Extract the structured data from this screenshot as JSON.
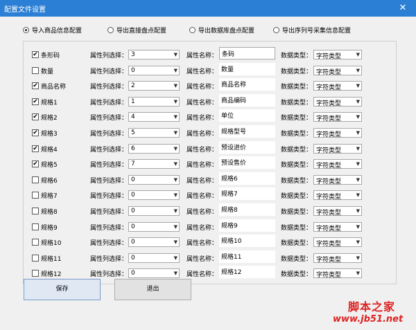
{
  "window": {
    "title": "配置文件设置",
    "close_glyph": "✕"
  },
  "tabs": [
    {
      "label": "导入商品信息配置",
      "selected": true
    },
    {
      "label": "导出直接盘点配置",
      "selected": false
    },
    {
      "label": "导出数据库盘点配置",
      "selected": false
    },
    {
      "label": "导出序列号采集信息配置",
      "selected": false
    }
  ],
  "labels": {
    "col_select": "属性列选择：",
    "attr_name": "属性名称：",
    "data_type": "数据类型："
  },
  "rows": [
    {
      "checked": true,
      "label": "条形码",
      "col": "3",
      "name": "条码",
      "name_framed": true,
      "type": "字符类型"
    },
    {
      "checked": false,
      "label": "数量",
      "col": "0",
      "name": "数量",
      "name_framed": false,
      "type": "字符类型"
    },
    {
      "checked": true,
      "label": "商品名称",
      "col": "2",
      "name": "商品名称",
      "name_framed": false,
      "type": "字符类型"
    },
    {
      "checked": true,
      "label": "规格1",
      "col": "1",
      "name": "商品编码",
      "name_framed": false,
      "type": "字符类型"
    },
    {
      "checked": true,
      "label": "规格2",
      "col": "4",
      "name": "单位",
      "name_framed": false,
      "type": "字符类型"
    },
    {
      "checked": true,
      "label": "规格3",
      "col": "5",
      "name": "规格型号",
      "name_framed": false,
      "type": "字符类型"
    },
    {
      "checked": true,
      "label": "规格4",
      "col": "6",
      "name": "预设进价",
      "name_framed": false,
      "type": "字符类型"
    },
    {
      "checked": true,
      "label": "规格5",
      "col": "7",
      "name": "预设售价",
      "name_framed": false,
      "type": "字符类型"
    },
    {
      "checked": false,
      "label": "规格6",
      "col": "0",
      "name": "规格6",
      "name_framed": false,
      "type": "字符类型"
    },
    {
      "checked": false,
      "label": "规格7",
      "col": "0",
      "name": "规格7",
      "name_framed": false,
      "type": "字符类型"
    },
    {
      "checked": false,
      "label": "规格8",
      "col": "0",
      "name": "规格8",
      "name_framed": false,
      "type": "字符类型"
    },
    {
      "checked": false,
      "label": "规格9",
      "col": "0",
      "name": "规格9",
      "name_framed": false,
      "type": "字符类型"
    },
    {
      "checked": false,
      "label": "规格10",
      "col": "0",
      "name": "规格10",
      "name_framed": false,
      "type": "字符类型"
    },
    {
      "checked": false,
      "label": "规格11",
      "col": "0",
      "name": "规格11",
      "name_framed": false,
      "type": "字符类型"
    },
    {
      "checked": false,
      "label": "规格12",
      "col": "0",
      "name": "规格12",
      "name_framed": false,
      "type": "字符类型"
    }
  ],
  "buttons": {
    "save": "保存",
    "exit": "退出"
  },
  "watermark": {
    "line1": "脚本之家",
    "line2": "www.jb51.net"
  }
}
